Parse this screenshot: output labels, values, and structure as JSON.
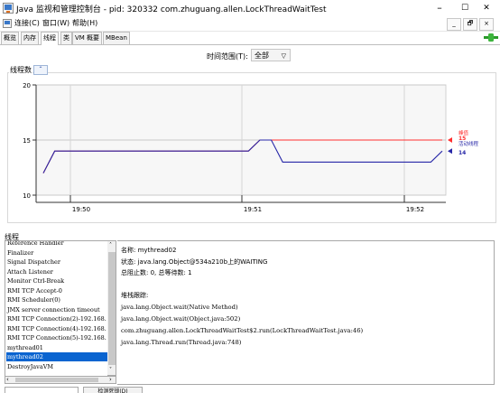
{
  "window": {
    "title": "Java 监视和管理控制台 - pid: 320332 com.zhuguang.allen.LockThreadWaitTest",
    "minimize": "–",
    "maximize": "☐",
    "close": "✕"
  },
  "menu": {
    "items": [
      {
        "label": "连接(C)"
      },
      {
        "label": "窗口(W)"
      },
      {
        "label": "帮助(H)"
      }
    ],
    "inner_controls": [
      "_",
      "🗗",
      "×"
    ]
  },
  "tabs": [
    {
      "label": "概览",
      "active": false
    },
    {
      "label": "内存",
      "active": false
    },
    {
      "label": "线程",
      "active": true
    },
    {
      "label": "类",
      "active": false
    },
    {
      "label": "VM 概要",
      "active": false
    },
    {
      "label": "MBean",
      "active": false
    }
  ],
  "time_range": {
    "label": "时间范围(T):",
    "value": "全部"
  },
  "thread_count": {
    "label": "线程数",
    "collapse_icon": "chevron-up-icon"
  },
  "chart_data": {
    "type": "line",
    "x_ticks": [
      "19:50",
      "19:51",
      "19:52"
    ],
    "y_ticks": [
      10,
      15,
      20
    ],
    "ylim": [
      10,
      20
    ],
    "grid": true,
    "legend_placement": "right",
    "series": [
      {
        "name": "峰值",
        "color": "#ff3030",
        "last_value_label": "15",
        "values": [
          12,
          14,
          14,
          14,
          14,
          14,
          14,
          14,
          14,
          14,
          14,
          14,
          14,
          14,
          14,
          14,
          14,
          14,
          14,
          15,
          15,
          15,
          15,
          15,
          15,
          15,
          15,
          15,
          15,
          15,
          15,
          15,
          15,
          15,
          15,
          15
        ]
      },
      {
        "name": "活动线程",
        "color": "#2828a8",
        "last_value_label": "14",
        "values": [
          12,
          14,
          14,
          14,
          14,
          14,
          14,
          14,
          14,
          14,
          14,
          14,
          14,
          14,
          14,
          14,
          14,
          14,
          14,
          15,
          15,
          13,
          13,
          13,
          13,
          13,
          13,
          13,
          13,
          13,
          13,
          13,
          13,
          13,
          13,
          14
        ]
      }
    ]
  },
  "threads": {
    "label": "线程",
    "items": [
      {
        "name": "Reference Handler",
        "selected": false
      },
      {
        "name": "Finalizer",
        "selected": false
      },
      {
        "name": "Signal Dispatcher",
        "selected": false
      },
      {
        "name": "Attach Listener",
        "selected": false
      },
      {
        "name": "Monitor Ctrl-Break",
        "selected": false
      },
      {
        "name": "RMI TCP Accept-0",
        "selected": false
      },
      {
        "name": "RMI Scheduler(0)",
        "selected": false
      },
      {
        "name": "JMX server connection timeout",
        "selected": false
      },
      {
        "name": "RMI TCP Connection(2)-192.168.",
        "selected": false
      },
      {
        "name": "RMI TCP Connection(4)-192.168.",
        "selected": false
      },
      {
        "name": "RMI TCP Connection(5)-192.168.",
        "selected": false
      },
      {
        "name": "mythread01",
        "selected": false
      },
      {
        "name": "mythread02",
        "selected": true
      },
      {
        "name": "DestroyJavaVM",
        "selected": false
      }
    ],
    "filter_placeholder": "",
    "detect_deadlock_label": "检测死锁(D)"
  },
  "details": {
    "name_line": "名称: mythread02",
    "state_line": "状态: java.lang.Object@534a210b上的WAITING",
    "blocked_line": "总阻止数: 0, 总等待数: 1",
    "stack_header": "堆栈跟踪:",
    "stack": [
      "java.lang.Object.wait(Native Method)",
      "java.lang.Object.wait(Object.java:502)",
      "com.zhuguang.allen.LockThreadWaitTest$2.run(LockThreadWaitTest.java:46)",
      "java.lang.Thread.run(Thread.java:748)"
    ]
  }
}
